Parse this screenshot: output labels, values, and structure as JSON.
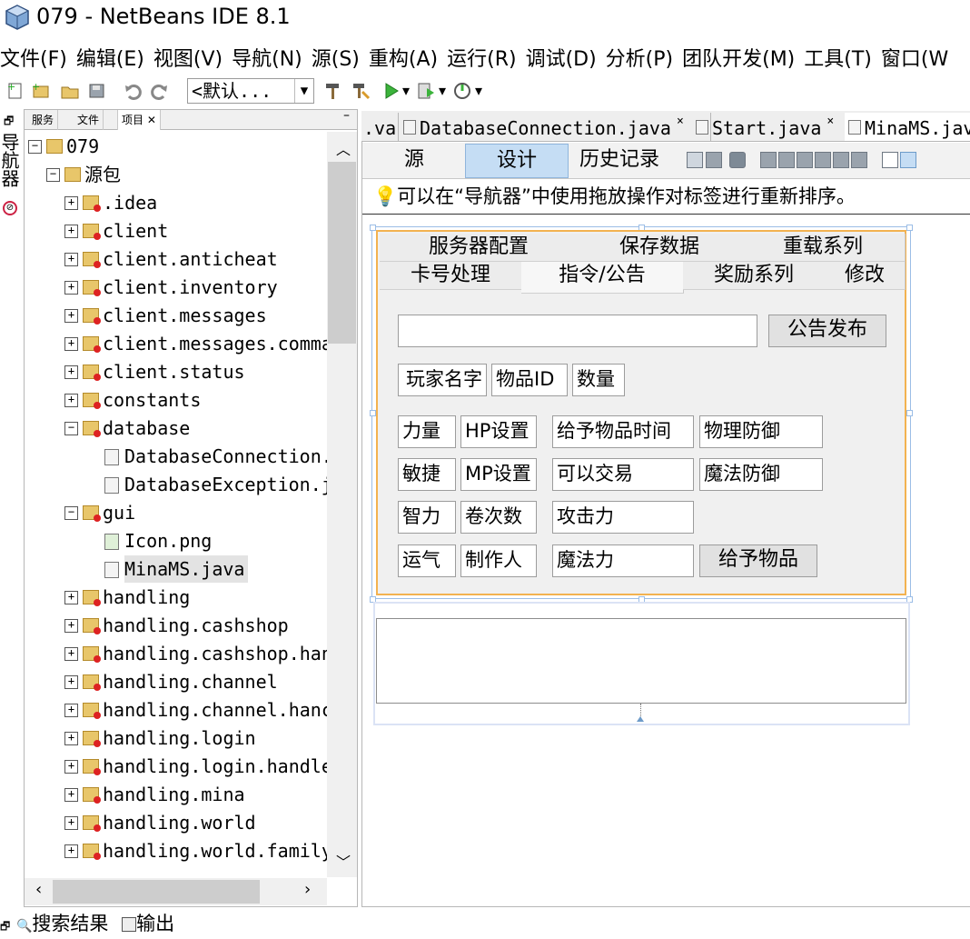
{
  "window": {
    "title": "079 - NetBeans IDE 8.1"
  },
  "menu": [
    "文件(F)",
    "编辑(E)",
    "视图(V)",
    "导航(N)",
    "源(S)",
    "重构(A)",
    "运行(R)",
    "调试(D)",
    "分析(P)",
    "团队开发(M)",
    "工具(T)",
    "窗口(W"
  ],
  "toolbar": {
    "config": "<默认..."
  },
  "nav_strip": {
    "label": "导航器"
  },
  "project_panel": {
    "tabs": [
      "服务",
      "文件",
      "项目"
    ],
    "minimize": "–",
    "tree": [
      {
        "label": "079",
        "exp": "−"
      },
      {
        "label": "源包",
        "exp": "−"
      },
      {
        "label": ".idea",
        "exp": "+"
      },
      {
        "label": "client",
        "exp": "+"
      },
      {
        "label": "client.anticheat",
        "exp": "+"
      },
      {
        "label": "client.inventory",
        "exp": "+"
      },
      {
        "label": "client.messages",
        "exp": "+"
      },
      {
        "label": "client.messages.comma",
        "exp": "+"
      },
      {
        "label": "client.status",
        "exp": "+"
      },
      {
        "label": "constants",
        "exp": "+"
      },
      {
        "label": "database",
        "exp": "−"
      },
      {
        "label": "DatabaseConnection.",
        "exp": ""
      },
      {
        "label": "DatabaseException.j",
        "exp": ""
      },
      {
        "label": "gui",
        "exp": "−"
      },
      {
        "label": "Icon.png",
        "exp": ""
      },
      {
        "label": "MinaMS.java",
        "exp": ""
      },
      {
        "label": "handling",
        "exp": "+"
      },
      {
        "label": "handling.cashshop",
        "exp": "+"
      },
      {
        "label": "handling.cashshop.han",
        "exp": "+"
      },
      {
        "label": "handling.channel",
        "exp": "+"
      },
      {
        "label": "handling.channel.hanc",
        "exp": "+"
      },
      {
        "label": "handling.login",
        "exp": "+"
      },
      {
        "label": "handling.login.handle",
        "exp": "+"
      },
      {
        "label": "handling.mina",
        "exp": "+"
      },
      {
        "label": "handling.world",
        "exp": "+"
      },
      {
        "label": "handling.world.family",
        "exp": "+"
      }
    ]
  },
  "editor": {
    "tabs": [
      ".va",
      "DatabaseConnection.java",
      "Start.java",
      "MinaMS.jav"
    ],
    "view_tabs": [
      "源",
      "设计",
      "历史记录"
    ],
    "hint": "可以在“导航器”中使用拖放操作对标签进行重新排序。"
  },
  "form": {
    "tabs_row1": [
      "服务器配置",
      "保存数据",
      "重载系列"
    ],
    "tabs_row2": [
      "卡号处理",
      "指令/公告",
      "奖励系列",
      "修改"
    ],
    "announce_button": "公告发布",
    "announce_value": "",
    "fields_row": [
      "玩家名字",
      "物品ID",
      "数量"
    ],
    "grid": [
      [
        "力量",
        "HP设置",
        "给予物品时间",
        "物理防御"
      ],
      [
        "敏捷",
        "MP设置",
        "可以交易",
        "魔法防御"
      ],
      [
        "智力",
        "卷次数",
        "攻击力"
      ],
      [
        "运气",
        "制作人",
        "魔法力"
      ]
    ],
    "give_button": "给予物品"
  },
  "bottom": {
    "search": "搜索结果",
    "output": "输出"
  }
}
